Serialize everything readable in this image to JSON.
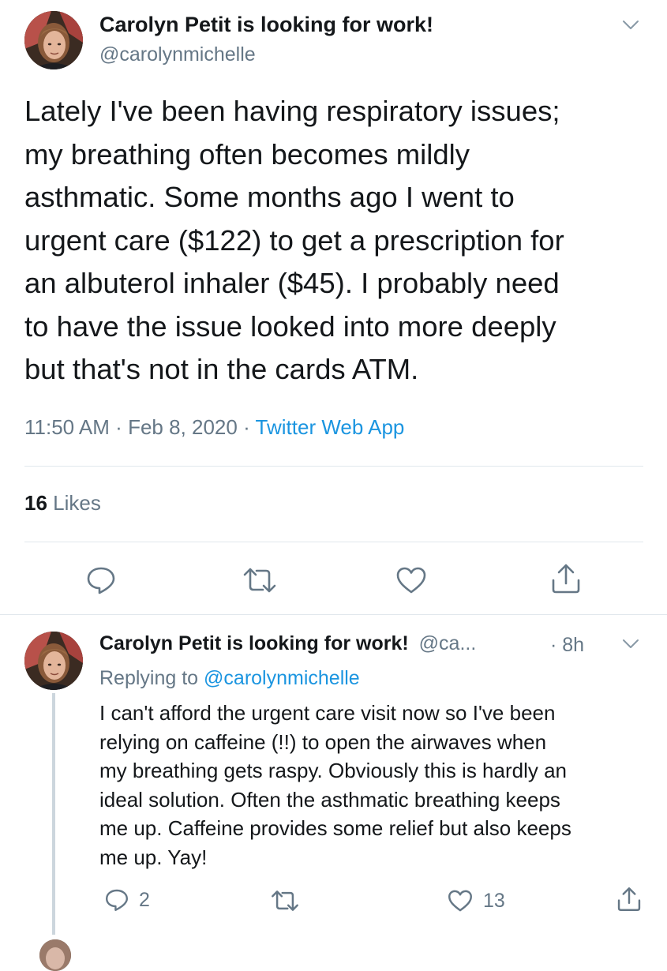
{
  "main_tweet": {
    "author_name": "Carolyn Petit is looking for work!",
    "handle": "@carolynmichelle",
    "text_lines": [
      "Lately I've been having respiratory issues;",
      "my breathing often becomes mildly",
      "asthmatic. Some months ago I went to",
      "urgent care ($122) to get a prescription for",
      "an albuterol inhaler ($45). I probably need",
      "to have the issue looked into more deeply",
      "but that's not in the cards ATM."
    ],
    "time": "11:50 AM",
    "date": "Feb 8, 2020",
    "separator": "·",
    "source": "Twitter Web App",
    "likes_count": "16",
    "likes_label": "Likes"
  },
  "reply_tweet": {
    "author_name": "Carolyn Petit is looking for work!",
    "handle_truncated": "@ca...",
    "age": "· 8h",
    "replying_to_label": "Replying to",
    "replying_to_handle": "@carolynmichelle",
    "text_lines": [
      "I can't afford the urgent care visit now so I've been",
      "relying on caffeine (!!) to open the airwaves when",
      "my breathing gets raspy. Obviously this is hardly an",
      "ideal solution. Often the asthmatic breathing keeps",
      "me up. Caffeine provides some relief but also keeps",
      "me up. Yay!"
    ],
    "reply_count": "2",
    "retweet_count": "",
    "like_count": "13"
  },
  "icons": {
    "reply": "reply-icon",
    "retweet": "retweet-icon",
    "like": "heart-icon",
    "share": "share-icon",
    "menu": "chevron-down-icon"
  },
  "colors": {
    "text": "#14171a",
    "secondary": "#657786",
    "link": "#1b95e0",
    "divider": "#e1e8ed",
    "thread_line": "#ccd6dd"
  }
}
